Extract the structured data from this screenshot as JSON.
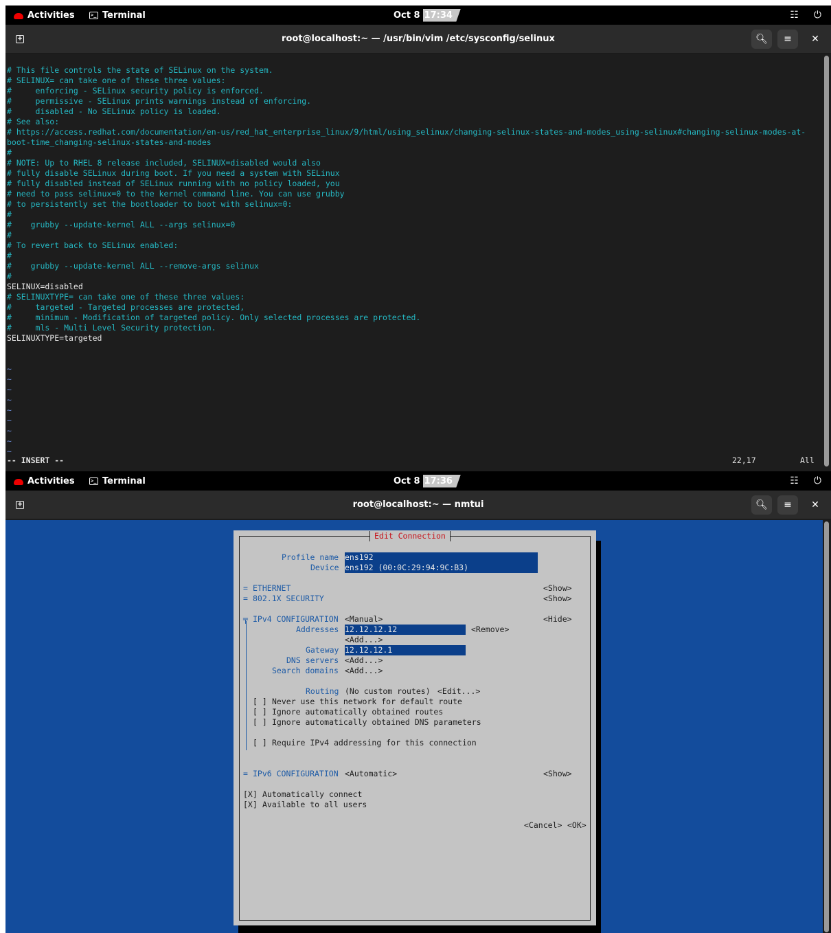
{
  "shot1": {
    "topbar": {
      "activities": "Activities",
      "app": "Terminal",
      "date": "Oct 8",
      "time": "17:34"
    },
    "header": {
      "title": "root@localhost:~ — /usr/bin/vim /etc/sysconfig/selinux"
    },
    "vim": {
      "lines": [
        "# This file controls the state of SELinux on the system.",
        "# SELINUX= can take one of these three values:",
        "#     enforcing - SELinux security policy is enforced.",
        "#     permissive - SELinux prints warnings instead of enforcing.",
        "#     disabled - No SELinux policy is loaded.",
        "# See also:",
        "# https://access.redhat.com/documentation/en-us/red_hat_enterprise_linux/9/html/using_selinux/changing-selinux-states-and-modes_using-selinux#changing-selinux-modes-at-",
        "boot-time_changing-selinux-states-and-modes",
        "#",
        "# NOTE: Up to RHEL 8 release included, SELINUX=disabled would also",
        "# fully disable SELinux during boot. If you need a system with SELinux",
        "# fully disabled instead of SELinux running with no policy loaded, you",
        "# need to pass selinux=0 to the kernel command line. You can use grubby",
        "# to persistently set the bootloader to boot with selinux=0:",
        "#",
        "#    grubby --update-kernel ALL --args selinux=0",
        "#",
        "# To revert back to SELinux enabled:",
        "#",
        "#    grubby --update-kernel ALL --remove-args selinux",
        "#",
        "SELINUX=disabled",
        "# SELINUXTYPE= can take one of these three values:",
        "#     targeted - Targeted processes are protected,",
        "#     minimum - Modification of targeted policy. Only selected processes are protected.",
        "#     mls - Multi Level Security protection.",
        "SELINUXTYPE=targeted"
      ],
      "tilde": "~",
      "mode": "-- INSERT --",
      "position": "22,17",
      "scroll": "All"
    }
  },
  "shot2": {
    "topbar": {
      "activities": "Activities",
      "app": "Terminal",
      "date": "Oct 8",
      "time": "17:36"
    },
    "header": {
      "title": "root@localhost:~ — nmtui"
    },
    "dialog": {
      "title": "Edit Connection",
      "profile_label": "Profile name",
      "profile_value": "ens192",
      "device_label": "Device",
      "device_value": "ens192 (00:0C:29:94:9C:B3)",
      "ethernet": "ETHERNET",
      "security": "802.1X SECURITY",
      "show": "<Show>",
      "ipv4_label": "IPv4 CONFIGURATION",
      "ipv4_mode": "<Manual>",
      "hide": "<Hide>",
      "addresses_label": "Addresses",
      "address_value": "12.12.12.12",
      "remove": "<Remove>",
      "add": "<Add...>",
      "gateway_label": "Gateway",
      "gateway_value": "12.12.12.1",
      "dns_label": "DNS servers",
      "search_label": "Search domains",
      "routing_label": "Routing",
      "routing_value": "(No custom routes)",
      "edit": "<Edit...>",
      "never_default": "Never use this network for default route",
      "ignore_routes": "Ignore automatically obtained routes",
      "ignore_dns": "Ignore automatically obtained DNS parameters",
      "require_ipv4": "Require IPv4 addressing for this connection",
      "ipv6_label": "IPv6 CONFIGURATION",
      "ipv6_mode": "<Automatic>",
      "auto_connect": "Automatically connect",
      "all_users": "Available to all users",
      "unchecked": "[ ]",
      "checked": "[X]",
      "cancel": "<Cancel>",
      "ok": "<OK>"
    }
  },
  "colors": {
    "comment": "#25b7c2",
    "tilde": "#6b8cd8",
    "nmtui_bg": "#134c9c",
    "dialog_bg": "#c4c4c4",
    "dialog_title": "#c6131b",
    "field_bg": "#0b3f8a",
    "label_blue": "#1c5aa6"
  },
  "icons": {
    "redhat": "redhat-logo-icon",
    "terminal": "terminal-icon",
    "network": "network-wired-icon",
    "power": "power-icon",
    "new_tab": "new-tab-icon",
    "search": "search-icon",
    "menu": "hamburger-menu-icon",
    "close": "close-icon"
  }
}
